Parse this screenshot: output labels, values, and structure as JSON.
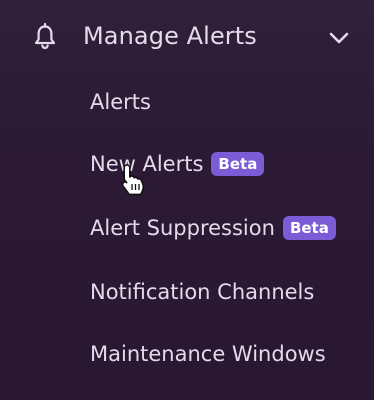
{
  "menu": {
    "header": {
      "label": "Manage Alerts",
      "icon": "bell-icon",
      "toggle_icon": "chevron-down-icon"
    },
    "items": [
      {
        "label": "Alerts",
        "badge": ""
      },
      {
        "label": "New Alerts",
        "badge": "Beta"
      },
      {
        "label": "Alert Suppression",
        "badge": "Beta"
      },
      {
        "label": "Notification Channels",
        "badge": ""
      },
      {
        "label": "Maintenance Windows",
        "badge": ""
      }
    ]
  },
  "colors": {
    "background": "#2b1a33",
    "text": "#e3dbe9",
    "badge": "#7b5bd6"
  }
}
